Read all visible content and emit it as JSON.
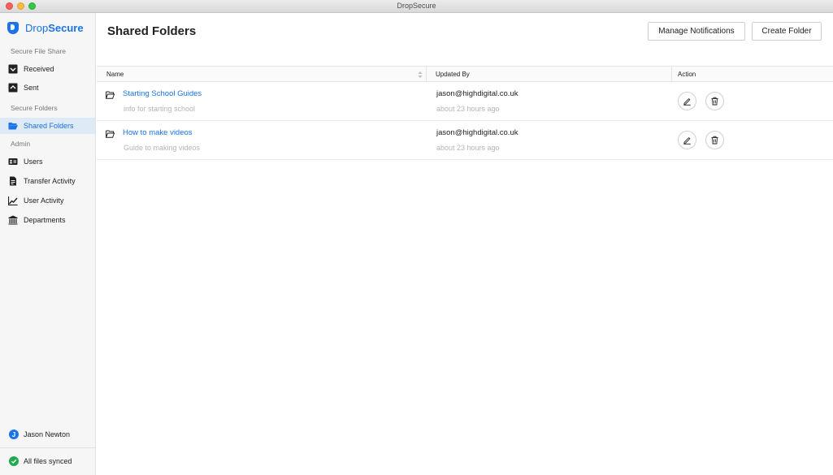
{
  "window": {
    "title": "DropSecure"
  },
  "brand": {
    "prefix": "Drop",
    "suffix": "Secure",
    "color": "#1a73e8"
  },
  "sidebar": {
    "sections": [
      {
        "label": "Secure File Share"
      },
      {
        "label": "Secure Folders"
      },
      {
        "label": "Admin"
      }
    ],
    "items": [
      {
        "label": "Received",
        "icon": "inbox-down-icon"
      },
      {
        "label": "Sent",
        "icon": "outbox-up-icon"
      },
      {
        "label": "Shared Folders",
        "icon": "folder-open-icon",
        "active": true
      },
      {
        "label": "Users",
        "icon": "id-card-icon"
      },
      {
        "label": "Transfer Activity",
        "icon": "document-icon"
      },
      {
        "label": "User Activity",
        "icon": "line-chart-icon"
      },
      {
        "label": "Departments",
        "icon": "building-icon"
      }
    ],
    "user": {
      "initial": "J",
      "name": "Jason Newton"
    },
    "sync": {
      "status": "All files synced"
    }
  },
  "main": {
    "title": "Shared Folders",
    "buttons": {
      "manage_notifications": "Manage Notifications",
      "create_folder": "Create Folder"
    },
    "table": {
      "columns": {
        "name": "Name",
        "updated_by": "Updated By",
        "action": "Action"
      },
      "rows": [
        {
          "name": "Starting School Guides",
          "description": "info for starting school",
          "updated_by": "jason@highdigital.co.uk",
          "updated_at": "about 23 hours ago"
        },
        {
          "name": "How to make videos",
          "description": "Guide to making videos",
          "updated_by": "jason@highdigital.co.uk",
          "updated_at": "about 23 hours ago"
        }
      ]
    }
  }
}
